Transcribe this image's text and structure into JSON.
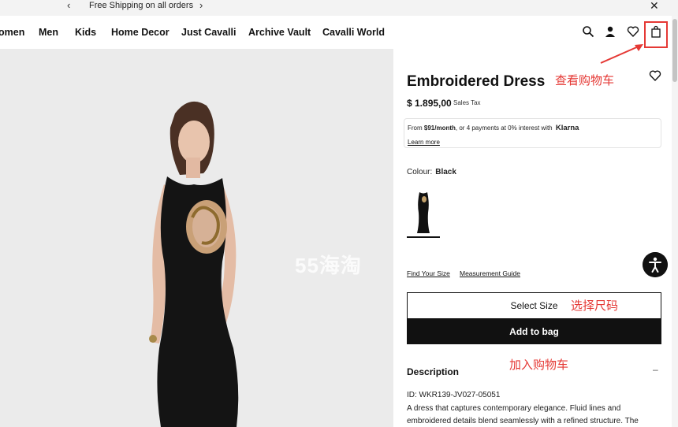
{
  "announcement": {
    "prev_icon": "chevron-left-icon",
    "message": "Free Shipping on all orders",
    "next_icon": "chevron-right-icon",
    "close_icon": "close-icon"
  },
  "nav": {
    "items": [
      "omen",
      "Men",
      "Kids",
      "Home Decor",
      "Just Cavalli",
      "Archive Vault",
      "Cavalli World"
    ],
    "icons": [
      "search-icon",
      "account-icon",
      "wishlist-icon",
      "bag-icon"
    ]
  },
  "annotations": {
    "view_cart": "查看购物车",
    "select_size": "选择尺码",
    "add_to_cart": "加入购物车",
    "color": "#e53935"
  },
  "watermark": "55海淘",
  "product": {
    "title": "Embroidered Dress",
    "price": "$ 1.895,00",
    "tax_label": "Sales Tax",
    "klarna": {
      "prefix": "From ",
      "amount": "$91/month",
      "suffix": ", or 4 payments at 0% interest with",
      "brand": "Klarna",
      "learn_more": "Learn more"
    },
    "colour_label": "Colour:",
    "colour_value": "Black",
    "find_size": "Find Your Size",
    "measurement_guide": "Measurement Guide",
    "select_size": "Select Size",
    "add_to_bag": "Add to bag",
    "description_heading": "Description",
    "description_toggle": "–",
    "product_id": "ID: WKR139-JV027-05051",
    "description_text": "A dress that captures contemporary elegance. Fluid lines and embroidered details blend seamlessly with a refined structure. The"
  }
}
